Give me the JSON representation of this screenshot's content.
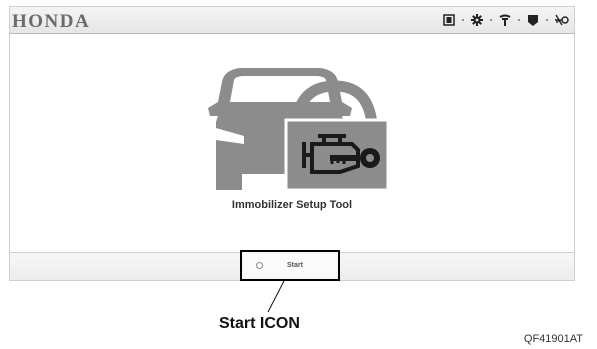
{
  "header": {
    "brand": "HONDA",
    "status_icons": [
      "battery-icon",
      "gear-icon",
      "antenna-icon",
      "signal-icon",
      "key-disabled-icon"
    ]
  },
  "main": {
    "tool_title": "Immobilizer Setup Tool",
    "start_label": "Start"
  },
  "annotation": {
    "callout": "Start ICON",
    "figure_id": "QF41901AT"
  }
}
